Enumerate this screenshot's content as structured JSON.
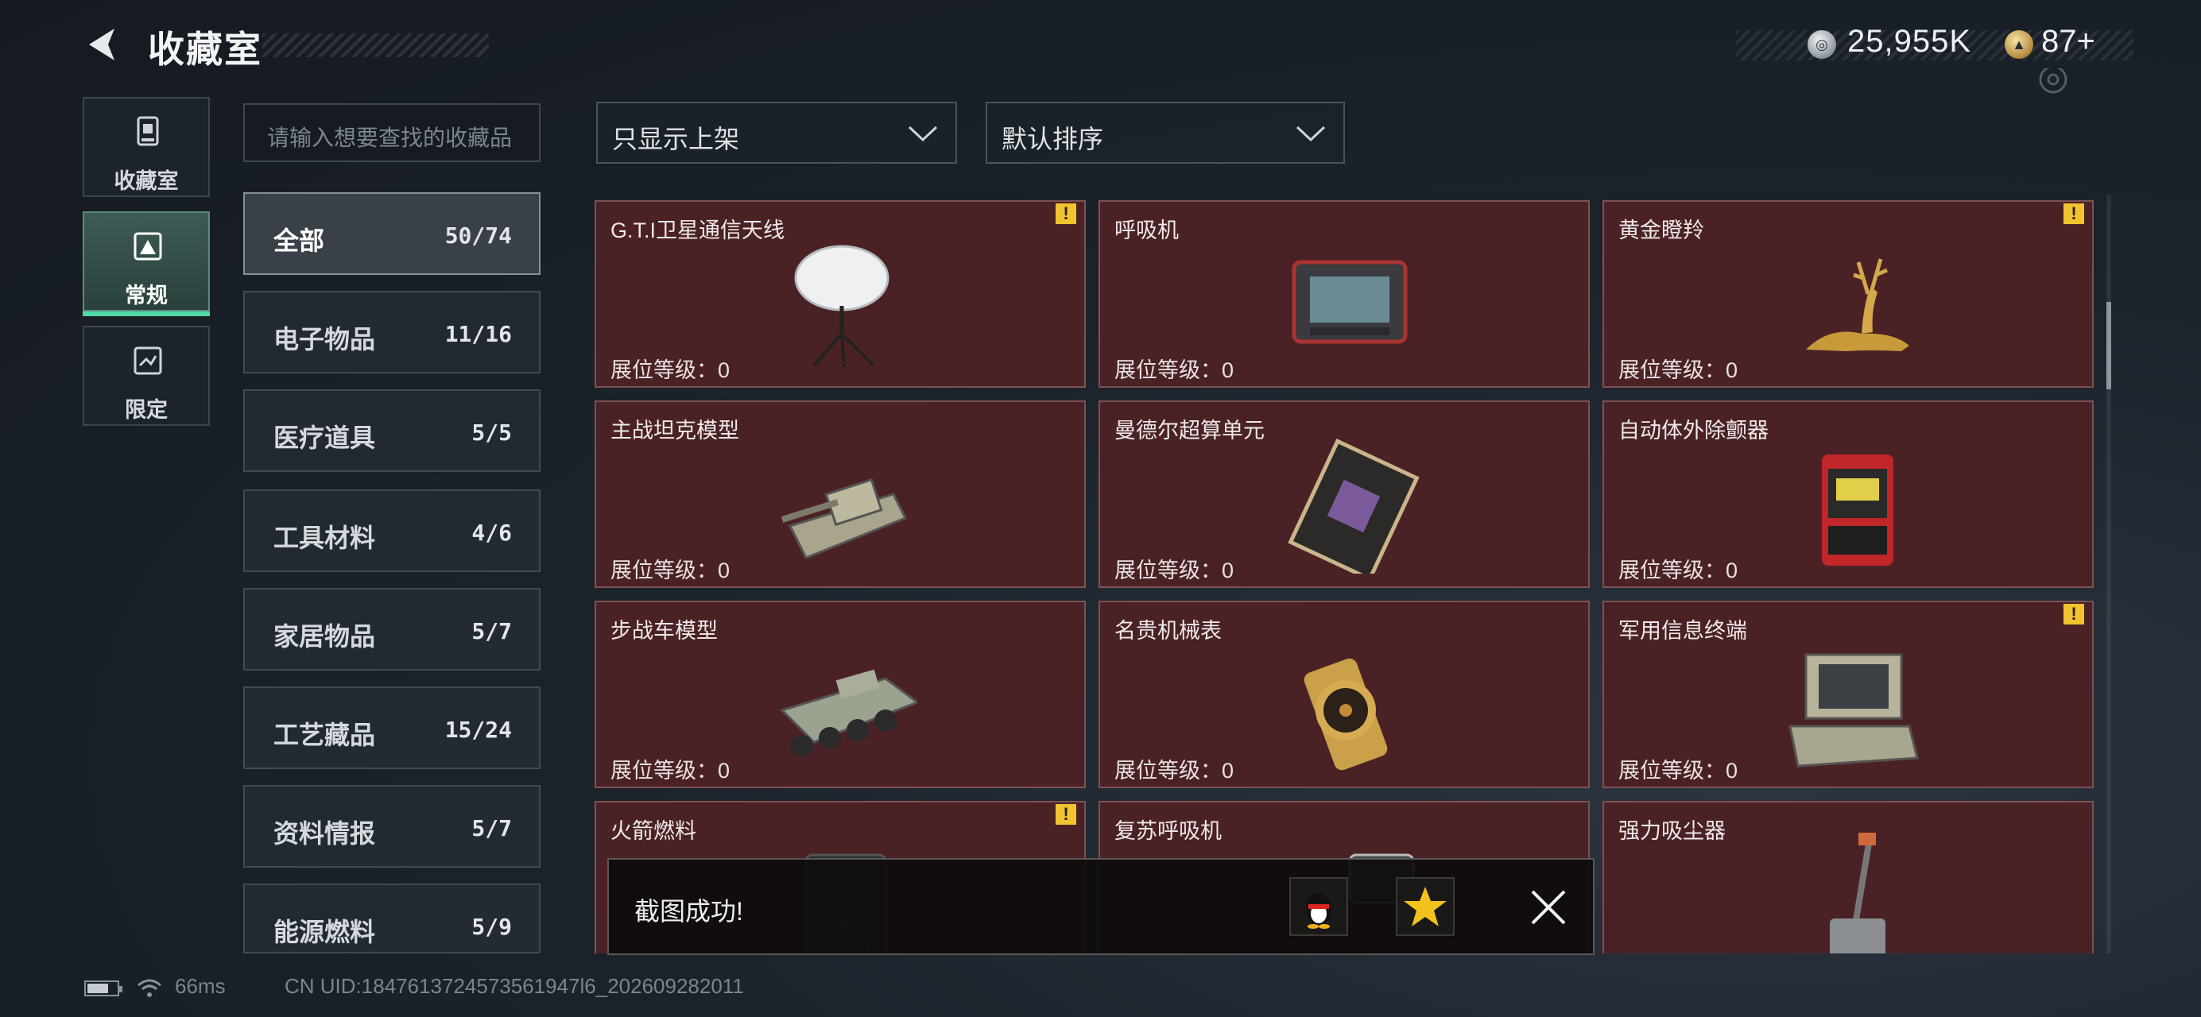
{
  "header": {
    "title": "收藏室",
    "silver_value": "25,955K",
    "gold_value": "87+"
  },
  "mode_tabs": [
    {
      "label": "收藏室",
      "icon": "collection-room-icon",
      "selected": false
    },
    {
      "label": "常规",
      "icon": "regular-items-icon",
      "selected": true
    },
    {
      "label": "限定",
      "icon": "limited-items-icon",
      "selected": false
    }
  ],
  "search": {
    "placeholder": "请输入想要查找的收藏品"
  },
  "filters": {
    "shelf_filter": "只显示上架",
    "sort": "默认排序"
  },
  "categories": [
    {
      "label": "全部",
      "count": "50/74",
      "active": true
    },
    {
      "label": "电子物品",
      "count": "11/16"
    },
    {
      "label": "医疗道具",
      "count": "5/5"
    },
    {
      "label": "工具材料",
      "count": "4/6"
    },
    {
      "label": "家居物品",
      "count": "5/7"
    },
    {
      "label": "工艺藏品",
      "count": "15/24"
    },
    {
      "label": "资料情报",
      "count": "5/7"
    },
    {
      "label": "能源燃料",
      "count": "5/9"
    }
  ],
  "items": [
    {
      "name": "G.T.I卫星通信天线",
      "level": "展位等级：0",
      "warning": true,
      "icon": "satellite-dish-icon"
    },
    {
      "name": "呼吸机",
      "level": "展位等级：0",
      "warning": false,
      "icon": "ventilator-icon"
    },
    {
      "name": "黄金瞪羚",
      "level": "展位等级：0",
      "warning": true,
      "icon": "golden-gazelle-icon"
    },
    {
      "name": "主战坦克模型",
      "level": "展位等级：0",
      "warning": false,
      "icon": "tank-model-icon"
    },
    {
      "name": "曼德尔超算单元",
      "level": "展位等级：0",
      "warning": false,
      "icon": "supercomputer-unit-icon"
    },
    {
      "name": "自动体外除颤器",
      "level": "展位等级：0",
      "warning": false,
      "icon": "defibrillator-icon"
    },
    {
      "name": "步战车模型",
      "level": "展位等级：0",
      "warning": false,
      "icon": "ifv-model-icon"
    },
    {
      "name": "名贵机械表",
      "level": "展位等级：0",
      "warning": false,
      "icon": "luxury-watch-icon"
    },
    {
      "name": "军用信息终端",
      "level": "展位等级：0",
      "warning": true,
      "icon": "military-terminal-icon"
    },
    {
      "name": "火箭燃料",
      "level": "",
      "warning": true,
      "icon": "jerrycan-icon"
    },
    {
      "name": "复苏呼吸机",
      "level": "",
      "warning": false,
      "icon": "resuscitator-icon"
    },
    {
      "name": "强力吸尘器",
      "level": "",
      "warning": false,
      "icon": "vacuum-cleaner-icon"
    }
  ],
  "toast": {
    "message": "截图成功!"
  },
  "footer": {
    "ping": "66ms",
    "uid": "CN UID:1847613724573561947l6_202609282011"
  },
  "colors": {
    "card_bg": "#4a2226",
    "accent_green": "#4fd9a7",
    "warning": "#f0c330"
  }
}
